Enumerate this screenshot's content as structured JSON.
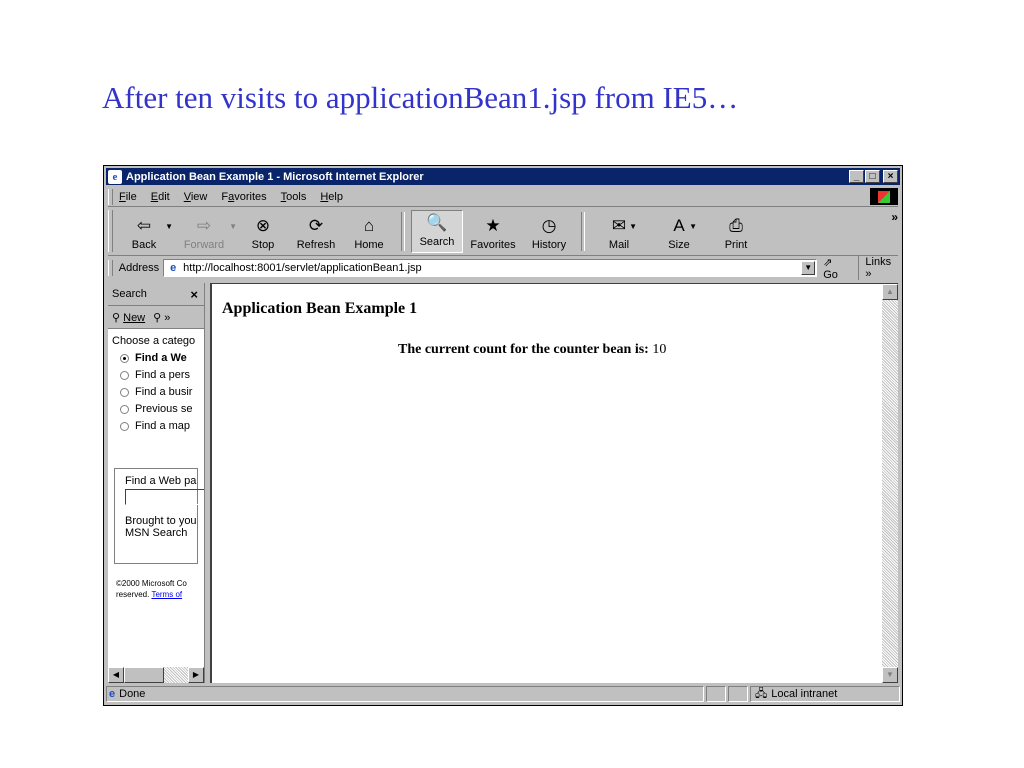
{
  "slide": {
    "title": "After ten visits to applicationBean1.jsp from IE5…"
  },
  "window": {
    "title": "Application Bean Example 1 - Microsoft Internet Explorer",
    "controls": {
      "minimize": "_",
      "maximize": "□",
      "close": "×"
    }
  },
  "menu": {
    "items": [
      {
        "first": "F",
        "rest": "ile"
      },
      {
        "first": "E",
        "rest": "dit"
      },
      {
        "first": "V",
        "rest": "iew"
      },
      {
        "pre": "F",
        "first": "a",
        "rest": "vorites"
      },
      {
        "first": "T",
        "rest": "ools"
      },
      {
        "first": "H",
        "rest": "elp"
      }
    ]
  },
  "toolbar": {
    "back": "Back",
    "forward": "Forward",
    "stop": "Stop",
    "refresh": "Refresh",
    "home": "Home",
    "search": "Search",
    "favorites": "Favorites",
    "history": "History",
    "mail": "Mail",
    "size": "Size",
    "print": "Print",
    "more": "»"
  },
  "address": {
    "label": "Address",
    "url": "http://localhost:8001/servlet/applicationBean1.jsp",
    "go": "Go",
    "links": "Links »"
  },
  "search_pane": {
    "title": "Search",
    "close": "×",
    "new": "New",
    "choose": "Choose a catego",
    "options": [
      {
        "label": "Find a We",
        "selected": true
      },
      {
        "label": "Find a pers",
        "selected": false
      },
      {
        "label": "Find a busir",
        "selected": false
      },
      {
        "label": "Previous se",
        "selected": false
      },
      {
        "label": "Find a map",
        "selected": false
      }
    ],
    "find_label": "Find a Web pa",
    "brought_1": "Brought to you",
    "brought_2": "MSN Search",
    "copyright_1": "©2000 Microsoft Co",
    "copyright_2": "reserved.",
    "terms": "Terms of"
  },
  "page": {
    "heading": "Application Bean Example 1",
    "counter_label": "The current count for the counter bean is:",
    "counter_value": "10"
  },
  "status": {
    "text": "Done",
    "zone": "Local intranet"
  }
}
